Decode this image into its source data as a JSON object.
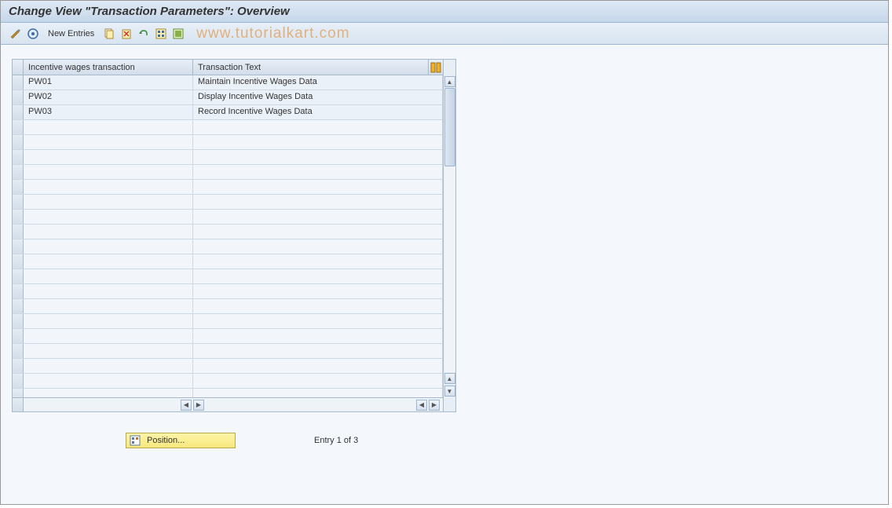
{
  "title": "Change View \"Transaction Parameters\": Overview",
  "toolbar": {
    "new_entries_label": "New Entries"
  },
  "watermark": "www.tutorialkart.com",
  "table": {
    "columns": {
      "col1": "Incentive wages transaction",
      "col2": "Transaction Text"
    },
    "rows": [
      {
        "code": "PW01",
        "text": "Maintain Incentive Wages Data"
      },
      {
        "code": "PW02",
        "text": "Display Incentive Wages Data"
      },
      {
        "code": "PW03",
        "text": "Record Incentive Wages Data"
      }
    ]
  },
  "footer": {
    "position_label": "Position...",
    "entry_status": "Entry 1 of 3"
  }
}
